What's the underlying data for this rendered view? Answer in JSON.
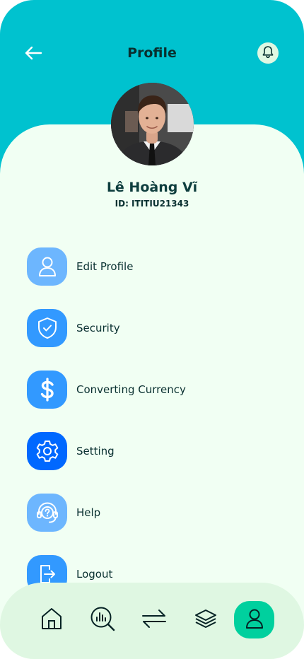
{
  "header": {
    "title": "Profile",
    "back_icon": "arrow-left-icon",
    "notification_icon": "bell-icon"
  },
  "user": {
    "name": "Lê Hoàng Vĩ",
    "id_text": "ID: ITITIU21343"
  },
  "menu": {
    "items": [
      {
        "label": "Edit Profile",
        "icon": "user-icon",
        "color": "#6DB6FE"
      },
      {
        "label": "Security",
        "icon": "shield-check-icon",
        "color": "#3299FF"
      },
      {
        "label": "Converting Currency",
        "icon": "dollar-icon",
        "color": "#3299FF"
      },
      {
        "label": "Setting",
        "icon": "gear-icon",
        "color": "#0068FF"
      },
      {
        "label": "Help",
        "icon": "help-headset-icon",
        "color": "#6DB6FE"
      },
      {
        "label": "Logout",
        "icon": "logout-icon",
        "color": "#3299FF"
      }
    ]
  },
  "bottom_nav": {
    "items": [
      {
        "icon": "home-icon",
        "active": false
      },
      {
        "icon": "analysis-icon",
        "active": false
      },
      {
        "icon": "transfer-icon",
        "active": false
      },
      {
        "icon": "layers-icon",
        "active": false
      },
      {
        "icon": "profile-icon",
        "active": true
      }
    ]
  },
  "colors": {
    "header_bg": "#00C2CF",
    "sheet_bg": "#F1FFF3",
    "nav_bg": "#DFF7E2",
    "active_nav": "#00D09E",
    "text_dark": "#093030"
  }
}
